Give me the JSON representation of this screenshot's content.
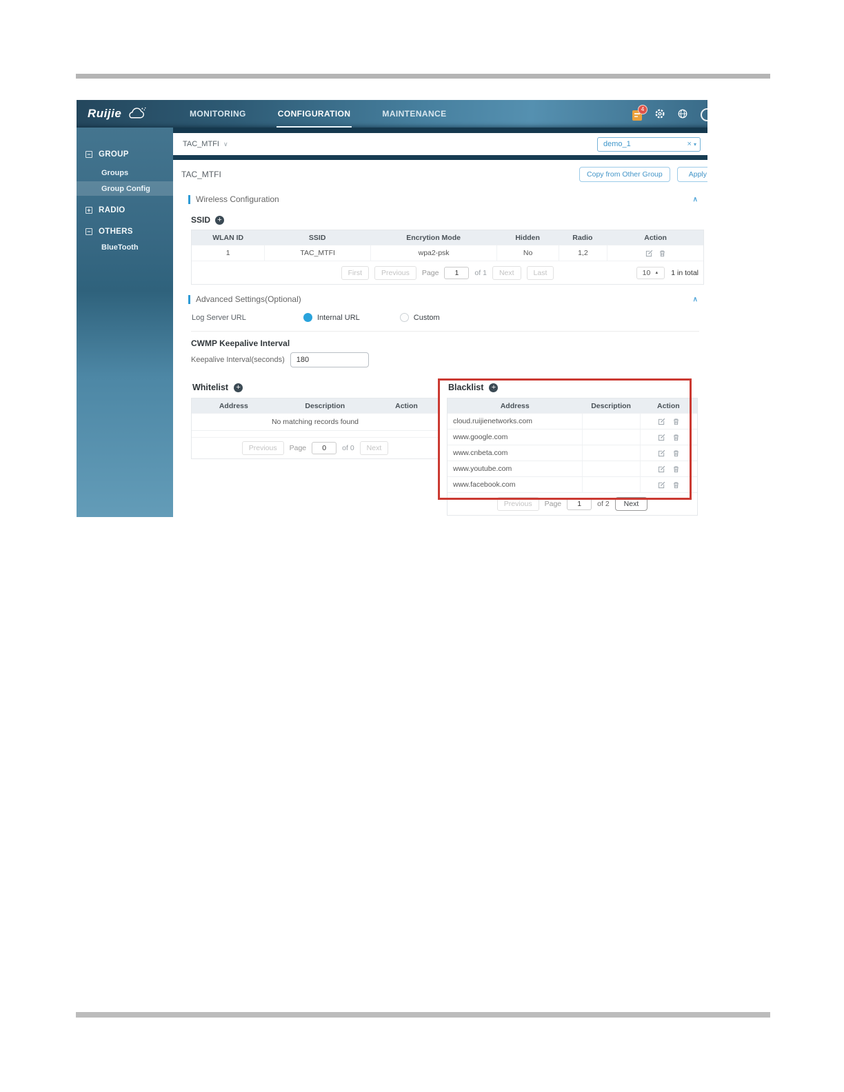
{
  "icons": {
    "minus": "−",
    "plus": "+",
    "chevron_up": "∧",
    "chevron_down": "∨",
    "close": "×",
    "caret_down": "▾",
    "caret_up": "▲"
  },
  "nav": {
    "brand": "Ruijie",
    "tabs": [
      {
        "label": "MONITORING"
      },
      {
        "label": "CONFIGURATION"
      },
      {
        "label": "MAINTENANCE"
      }
    ],
    "notification_count": "4"
  },
  "sidebar": {
    "group_header": "GROUP",
    "groups_item": "Groups",
    "group_config_item": "Group Config",
    "radio_header": "RADIO",
    "others_header": "OTHERS",
    "bluetooth_item": "BlueTooth"
  },
  "breadcrumb": {
    "current": "TAC_MTFI"
  },
  "group_select": {
    "value": "demo_1"
  },
  "page": {
    "title": "TAC_MTFI",
    "copy_button": "Copy from Other Group",
    "apply_button": "Apply"
  },
  "wireless": {
    "section_title": "Wireless Configuration",
    "ssid_label": "SSID",
    "headers": [
      "WLAN ID",
      "SSID",
      "Encrytion Mode",
      "Hidden",
      "Radio",
      "Action"
    ],
    "row": {
      "wlan_id": "1",
      "ssid": "TAC_MTFI",
      "encryption": "wpa2-psk",
      "hidden": "No",
      "radio": "1,2"
    },
    "pagination": {
      "first": "First",
      "previous": "Previous",
      "page_label": "Page",
      "page_value": "1",
      "of": "of 1",
      "next": "Next",
      "last": "Last",
      "page_size": "10",
      "total": "1 in total"
    }
  },
  "advanced": {
    "section_title": "Advanced Settings(Optional)",
    "log_server_label": "Log Server URL",
    "internal_url_option": "Internal URL",
    "custom_option": "Custom",
    "cwmp_title": "CWMP Keepalive Interval",
    "keepalive_label": "Keepalive Interval(seconds)",
    "keepalive_value": "180"
  },
  "whitelist": {
    "title": "Whitelist",
    "headers": [
      "Address",
      "Description",
      "Action"
    ],
    "empty_text": "No matching records found",
    "pagination": {
      "previous": "Previous",
      "page_label": "Page",
      "page_value": "0",
      "of": "of 0",
      "next": "Next"
    }
  },
  "blacklist": {
    "title": "Blacklist",
    "headers": [
      "Address",
      "Description",
      "Action"
    ],
    "rows": [
      "cloud.ruijienetworks.com",
      "www.google.com",
      "www.cnbeta.com",
      "www.youtube.com",
      "www.facebook.com"
    ],
    "pagination": {
      "previous": "Previous",
      "page_label": "Page",
      "page_value": "1",
      "of": "of 2",
      "next": "Next"
    }
  }
}
